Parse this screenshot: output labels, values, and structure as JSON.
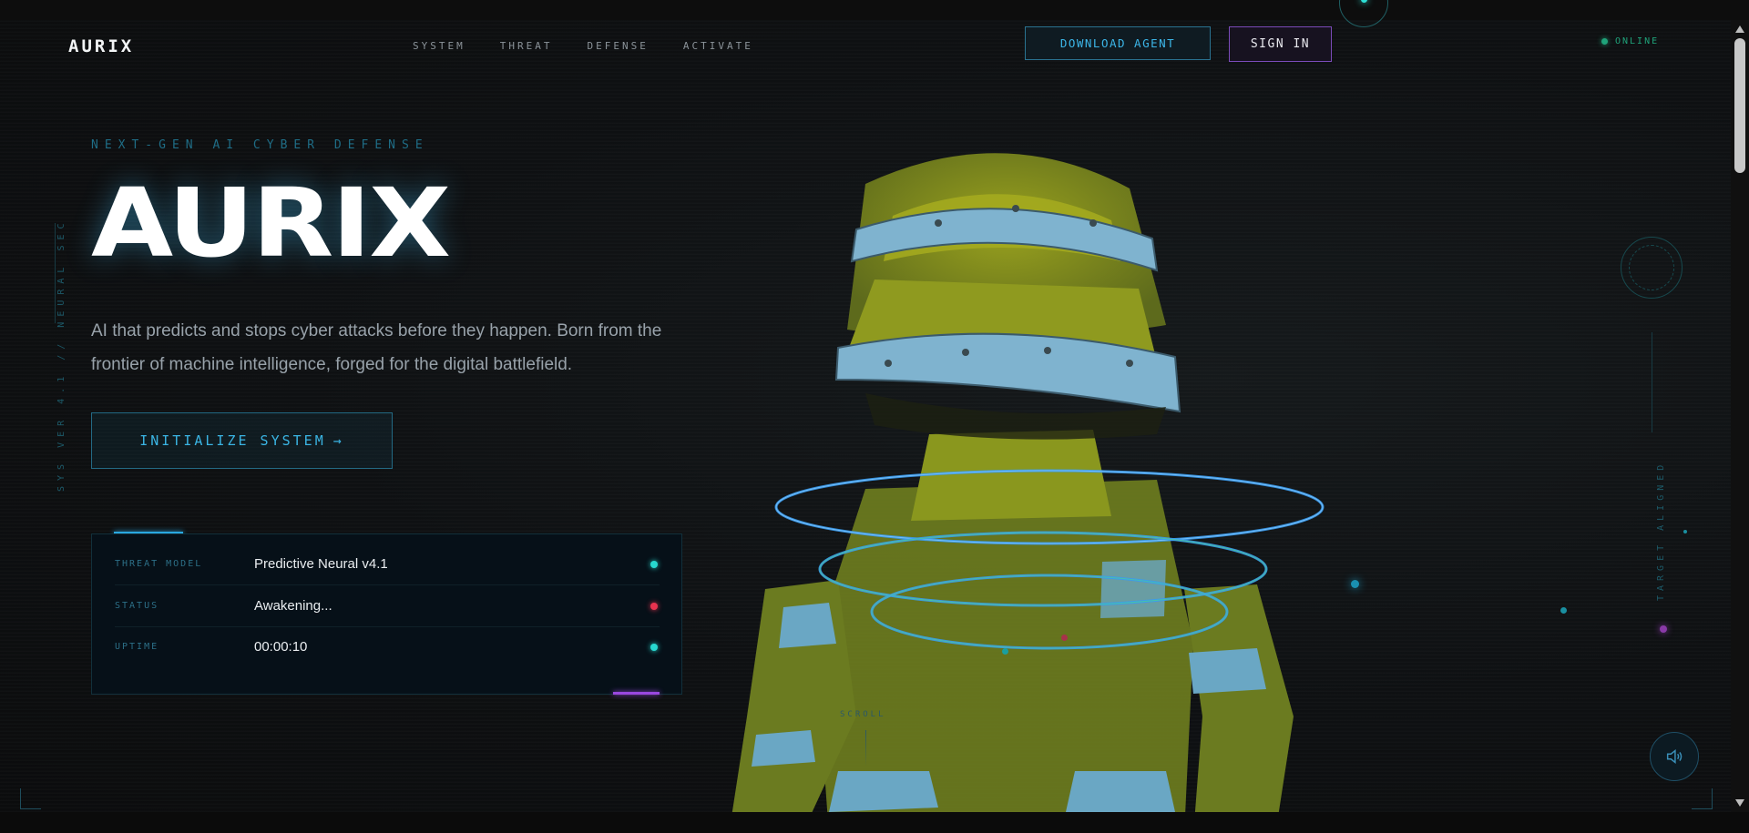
{
  "brand": {
    "logo": "AURIX"
  },
  "nav": {
    "items": [
      {
        "label": "SYSTEM"
      },
      {
        "label": "THREAT"
      },
      {
        "label": "DEFENSE"
      },
      {
        "label": "ACTIVATE"
      }
    ],
    "download_label": "DOWNLOAD AGENT",
    "signin_label": "SIGN IN",
    "status_label": "ONLINE"
  },
  "hero": {
    "tagline": "NEXT-GEN AI CYBER DEFENSE",
    "title": "AURIX",
    "description": "AI that predicts and stops cyber attacks before they happen. Born from the frontier of machine intelligence, forged for the digital battlefield.",
    "cta_label": "INITIALIZE SYSTEM",
    "cta_arrow": "→"
  },
  "side": {
    "left_vertical": "SYS VER 4.1 // NEURAL SEC",
    "right_vertical": "TARGET ALIGNED",
    "scroll_label": "SCROLL"
  },
  "status_panel": {
    "rows": [
      {
        "label": "THREAT MODEL",
        "value": "Predictive Neural v4.1",
        "dot_color": "#27d9d0"
      },
      {
        "label": "STATUS",
        "value": "Awakening...",
        "dot_color": "#e8334f"
      },
      {
        "label": "UPTIME",
        "value": "00:00:10",
        "dot_color": "#27d9d0"
      }
    ]
  },
  "icons": {
    "sound": "speaker-icon",
    "scroll_arrows": [
      "chevron-up-icon",
      "chevron-down-icon"
    ]
  },
  "colors": {
    "accent_cyan": "#3ab4e3",
    "accent_purple": "#9a48e0",
    "online_green": "#1fa37a",
    "background": "#0b0c0d"
  }
}
